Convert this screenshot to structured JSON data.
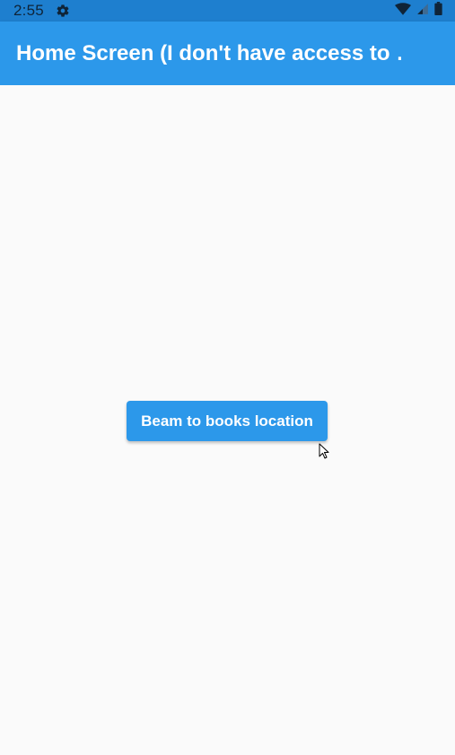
{
  "status_bar": {
    "time": "2:55",
    "icons": {
      "settings": "gear-icon",
      "wifi": "wifi-icon",
      "signal": "cell-signal-icon",
      "battery": "battery-icon"
    }
  },
  "app_bar": {
    "title": "Home Screen (I don't have access to …"
  },
  "main": {
    "button_label": "Beam to books location"
  },
  "colors": {
    "status_bar": "#1E7FCF",
    "app_bar": "#2C98EA",
    "background": "#FAFAFA",
    "button": "#2C98EA",
    "button_text": "#FFFFFF"
  }
}
